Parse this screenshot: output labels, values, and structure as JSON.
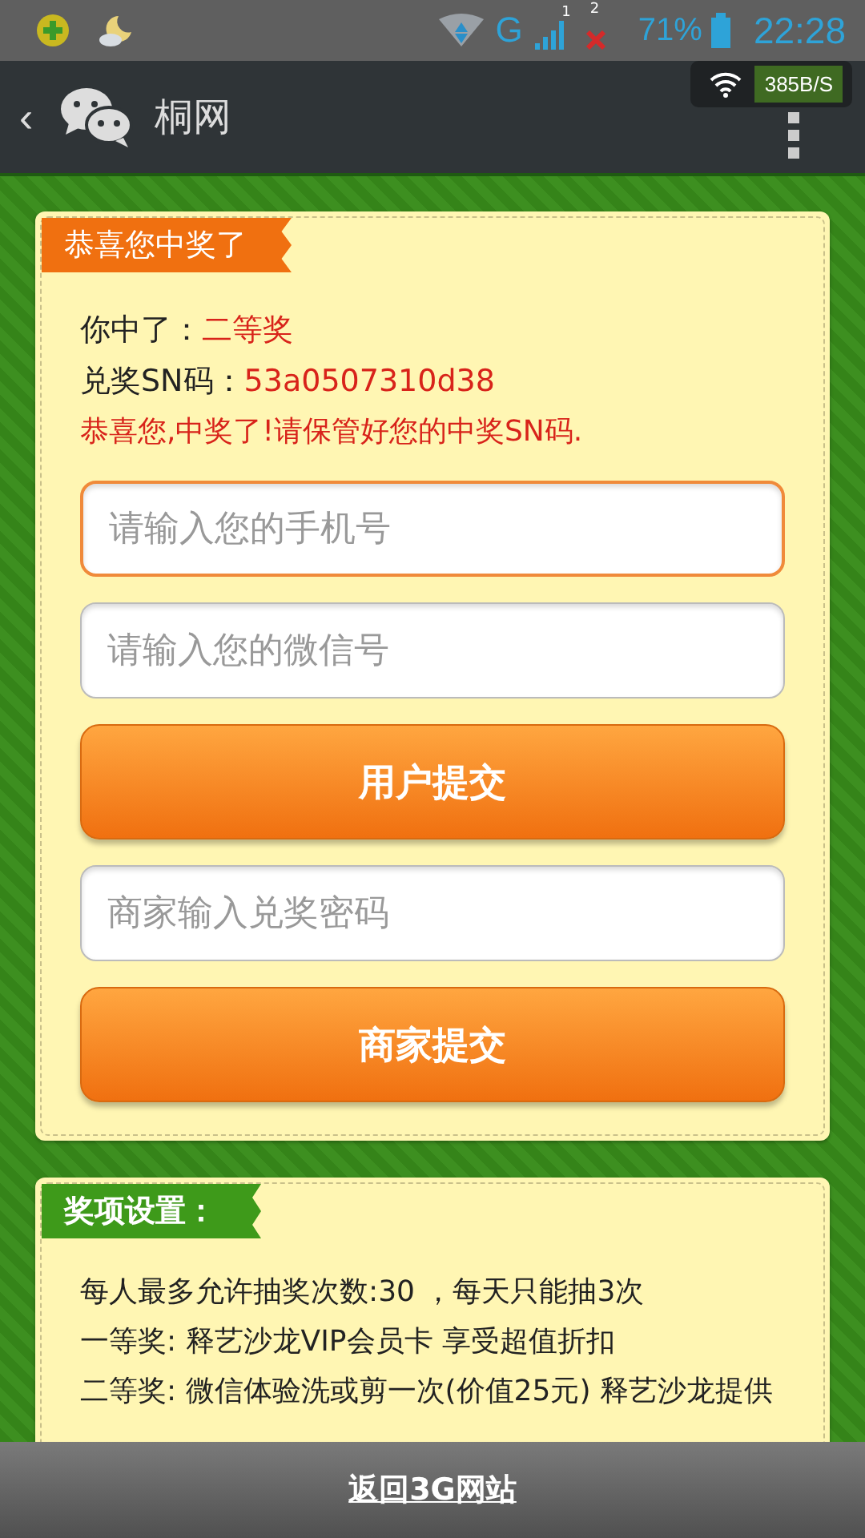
{
  "status_bar": {
    "sim1_label": "1",
    "sim2_label": "2",
    "network": "G",
    "battery": "71%",
    "time": "22:28"
  },
  "nav_bar": {
    "back": "‹",
    "title": "桐网",
    "speed": "385B/S"
  },
  "win_card": {
    "header": "恭喜您中奖了",
    "lines": [
      {
        "label": "你中了：",
        "value": "二等奖"
      },
      {
        "label": "兑奖SN码：",
        "value": "53a0507310d38"
      }
    ],
    "notice": "恭喜您,中奖了!请保管好您的中奖SN码.",
    "form": [
      {
        "kind": "input",
        "placeholder": "请输入您的手机号",
        "focused": true
      },
      {
        "kind": "input",
        "placeholder": "请输入您的微信号",
        "focused": false
      },
      {
        "kind": "button",
        "label": "用户提交"
      },
      {
        "kind": "input",
        "placeholder": "商家输入兑奖密码",
        "focused": false
      },
      {
        "kind": "button",
        "label": "商家提交"
      }
    ]
  },
  "prize_card": {
    "header": "奖项设置：",
    "lines": [
      "每人最多允许抽奖次数:30 ，每天只能抽3次",
      "一等奖: 释艺沙龙VIP会员卡 享受超值折扣",
      "二等奖: 微信体验洗或剪一次(价值25元) 释艺沙龙提供"
    ]
  },
  "footer_link": "返回3G网站"
}
